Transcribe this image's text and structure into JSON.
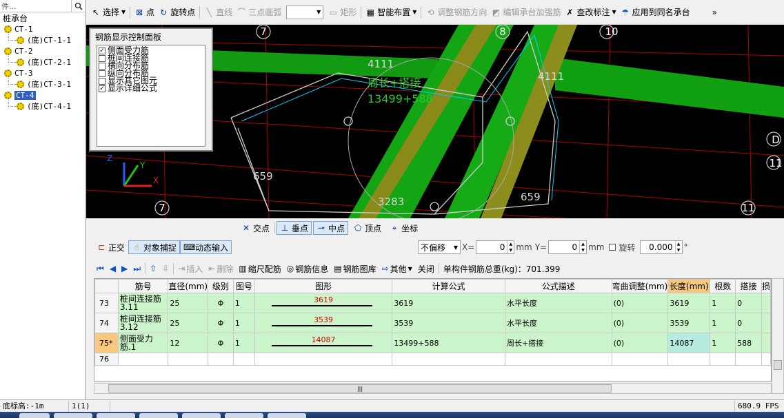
{
  "search": {
    "placeholder": "件..."
  },
  "tree": {
    "root": "桩承台",
    "items": [
      {
        "label": "CT-1",
        "child": "(底)CT-1-1"
      },
      {
        "label": "CT-2",
        "child": "(底)CT-2-1"
      },
      {
        "label": "CT-3",
        "child": "(底)CT-3-1"
      },
      {
        "label": "CT-4",
        "child": "(底)CT-4-1"
      }
    ],
    "selected": "CT-4"
  },
  "toolbar": {
    "select": "选择",
    "point": "点",
    "rotate_point": "旋转点",
    "line": "直线",
    "three_point_arc": "三点画弧",
    "rect": "矩形",
    "smart_layout": "智能布置",
    "adjust_direction": "调整钢筋方向",
    "edit_reinforce": "编辑承台加强筋",
    "check_label": "查改标注",
    "apply_same": "应用到同名承台",
    "more": "»"
  },
  "panel": {
    "title": "钢筋显示控制面板",
    "options": [
      {
        "label": "侧面受力筋",
        "checked": true
      },
      {
        "label": "桩间连接筋",
        "checked": false
      },
      {
        "label": "横向分布筋",
        "checked": false
      },
      {
        "label": "纵向分布筋",
        "checked": false
      },
      {
        "label": "显示其它图元",
        "checked": false
      },
      {
        "label": "显示详细公式",
        "checked": true
      }
    ]
  },
  "viewport": {
    "axis_labels": [
      "7",
      "8",
      "10",
      "7",
      "11",
      "11",
      "D"
    ],
    "dims": [
      "4111",
      "4111",
      "659",
      "659",
      "3283"
    ],
    "rebar_label": {
      "line1": "周长+搭接",
      "line2": "13499+588",
      "top": "4111"
    },
    "triad": {
      "z": "Z",
      "y": "Y",
      "x": "X"
    }
  },
  "snap": {
    "intersection": "交点",
    "perpendicular": "垂点",
    "midpoint": "中点",
    "vertex": "顶点",
    "coordinate": "坐标"
  },
  "controls": {
    "ortho": "正交",
    "object_snap": "对象捕捉",
    "dynamic_input": "动态输入",
    "offset_mode": "不偏移",
    "x_label": "X=",
    "x_value": "0",
    "unit": "mm",
    "y_label": "Y=",
    "y_value": "0",
    "rotate_label": "旋转",
    "rotate_value": "0.000",
    "degree": "°"
  },
  "grid_toolbar": {
    "insert": "插入",
    "delete": "删除",
    "scale_rebar": "缩尺配筋",
    "rebar_info": "钢筋信息",
    "rebar_library": "钢筋图库",
    "other": "其他",
    "close": "关闭",
    "total_weight": "单构件钢筋总重(kg)：701.399"
  },
  "table": {
    "headers": [
      "",
      "筋号",
      "直径(mm)",
      "级别",
      "图号",
      "图形",
      "计算公式",
      "公式描述",
      "弯曲调整(mm)",
      "长度(mm)",
      "根数",
      "搭接",
      "损"
    ],
    "rows": [
      {
        "index": "73",
        "name": "桩间连接筋3.11",
        "diameter": "25",
        "grade": "Φ",
        "figure": "1",
        "shape_value": "3619",
        "formula": "3619",
        "description": "水平长度",
        "bend": "(0)",
        "length": "3619",
        "count": "1",
        "lap": "0"
      },
      {
        "index": "74",
        "name": "桩间连接筋3.12",
        "diameter": "25",
        "grade": "Φ",
        "figure": "1",
        "shape_value": "3539",
        "formula": "3539",
        "description": "水平长度",
        "bend": "(0)",
        "length": "3539",
        "count": "1",
        "lap": "0"
      },
      {
        "index": "75*",
        "name": "侧面受力筋.1",
        "diameter": "12",
        "grade": "Φ",
        "figure": "1",
        "shape_value": "14087",
        "formula": "13499+588",
        "description": "周长+搭接",
        "bend": "(0)",
        "length": "14087",
        "count": "1",
        "lap": "588"
      }
    ],
    "empty_row": "76"
  },
  "status": {
    "elevation": "底标高:-1m",
    "count": "1(1)",
    "fps": "680.9 FPS"
  },
  "colors": {
    "accent": "#3060c0",
    "grid_row": "#ccf5cc",
    "header_highlight": "#f7c980",
    "rebar_green": "#11aa11",
    "rebar_yellow": "#8a8a1a"
  }
}
